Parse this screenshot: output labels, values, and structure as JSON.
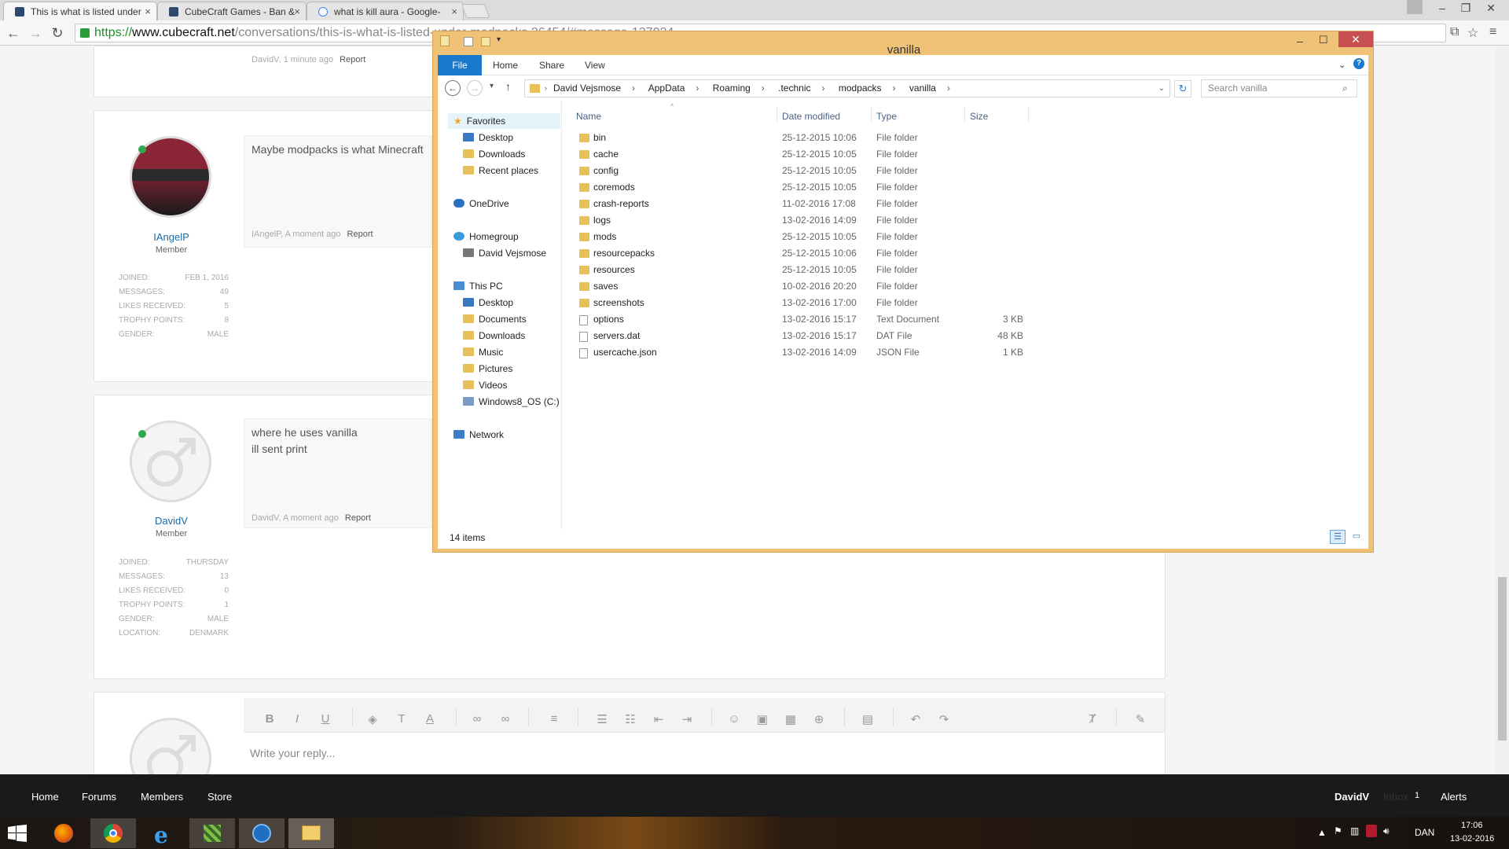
{
  "browser": {
    "tabs": [
      {
        "title": "This is what is listed under"
      },
      {
        "title": "CubeCraft Games - Ban &"
      },
      {
        "title": "what is kill aura - Google-"
      }
    ],
    "url_scheme": "https://",
    "url_domain": "www.cubecraft.net",
    "url_path": "/conversations/this-is-what-is-listed-under-modpacks.26454/#message-127024"
  },
  "forum": {
    "top_meta": {
      "author_time": "DavidV, 1 minute ago",
      "report": "Report"
    },
    "posts": [
      {
        "username": "IAngelP",
        "role": "Member",
        "message_lines": [
          "Maybe modpacks is what Minecraft"
        ],
        "meta": "IAngelP, A moment ago",
        "report": "Report",
        "stats": [
          {
            "label": "Joined:",
            "value": "Feb 1, 2016"
          },
          {
            "label": "Messages:",
            "value": "49"
          },
          {
            "label": "Likes Received:",
            "value": "5"
          },
          {
            "label": "Trophy Points:",
            "value": "8"
          },
          {
            "label": "Gender:",
            "value": "Male"
          }
        ]
      },
      {
        "username": "DavidV",
        "role": "Member",
        "message_lines": [
          "where he uses vanilla",
          "ill sent print"
        ],
        "meta": "DavidV, A moment ago",
        "report": "Report",
        "stats": [
          {
            "label": "Joined:",
            "value": "Thursday"
          },
          {
            "label": "Messages:",
            "value": "13"
          },
          {
            "label": "Likes Received:",
            "value": "0"
          },
          {
            "label": "Trophy Points:",
            "value": "1"
          },
          {
            "label": "Gender:",
            "value": "Male"
          },
          {
            "label": "Location:",
            "value": "Denmark"
          }
        ]
      }
    ],
    "reply_placeholder": "Write your reply..."
  },
  "footer": {
    "nav": [
      "Home",
      "Forums",
      "Members",
      "Store"
    ],
    "user": "DavidV",
    "inbox_label": "Inbox",
    "inbox_count": "1",
    "alerts": "Alerts"
  },
  "explorer": {
    "title": "vanilla",
    "ribbon_tabs": [
      "File",
      "Home",
      "Share",
      "View"
    ],
    "breadcrumb": [
      "David Vejsmose",
      "AppData",
      "Roaming",
      ".technic",
      "modpacks",
      "vanilla"
    ],
    "search_placeholder": "Search vanilla",
    "columns": [
      "Name",
      "Date modified",
      "Type",
      "Size"
    ],
    "nav_pane": {
      "favorites": "Favorites",
      "favorites_items": [
        "Desktop",
        "Downloads",
        "Recent places"
      ],
      "onedrive": "OneDrive",
      "homegroup": "Homegroup",
      "homegroup_items": [
        "David Vejsmose"
      ],
      "thispc": "This PC",
      "thispc_items": [
        "Desktop",
        "Documents",
        "Downloads",
        "Music",
        "Pictures",
        "Videos",
        "Windows8_OS (C:)"
      ],
      "network": "Network"
    },
    "files": [
      {
        "name": "bin",
        "date": "25-12-2015 10:06",
        "type": "File folder",
        "size": ""
      },
      {
        "name": "cache",
        "date": "25-12-2015 10:05",
        "type": "File folder",
        "size": ""
      },
      {
        "name": "config",
        "date": "25-12-2015 10:05",
        "type": "File folder",
        "size": ""
      },
      {
        "name": "coremods",
        "date": "25-12-2015 10:05",
        "type": "File folder",
        "size": ""
      },
      {
        "name": "crash-reports",
        "date": "11-02-2016 17:08",
        "type": "File folder",
        "size": ""
      },
      {
        "name": "logs",
        "date": "13-02-2016 14:09",
        "type": "File folder",
        "size": ""
      },
      {
        "name": "mods",
        "date": "25-12-2015 10:05",
        "type": "File folder",
        "size": ""
      },
      {
        "name": "resourcepacks",
        "date": "25-12-2015 10:06",
        "type": "File folder",
        "size": ""
      },
      {
        "name": "resources",
        "date": "25-12-2015 10:05",
        "type": "File folder",
        "size": ""
      },
      {
        "name": "saves",
        "date": "10-02-2016 20:20",
        "type": "File folder",
        "size": ""
      },
      {
        "name": "screenshots",
        "date": "13-02-2016 17:00",
        "type": "File folder",
        "size": ""
      },
      {
        "name": "options",
        "date": "13-02-2016 15:17",
        "type": "Text Document",
        "size": "3 KB"
      },
      {
        "name": "servers.dat",
        "date": "13-02-2016 15:17",
        "type": "DAT File",
        "size": "48 KB"
      },
      {
        "name": "usercache.json",
        "date": "13-02-2016 14:09",
        "type": "JSON File",
        "size": "1 KB"
      }
    ],
    "status": "14 items"
  },
  "taskbar": {
    "language": "DAN",
    "time": "17:06",
    "date": "13-02-2016"
  }
}
